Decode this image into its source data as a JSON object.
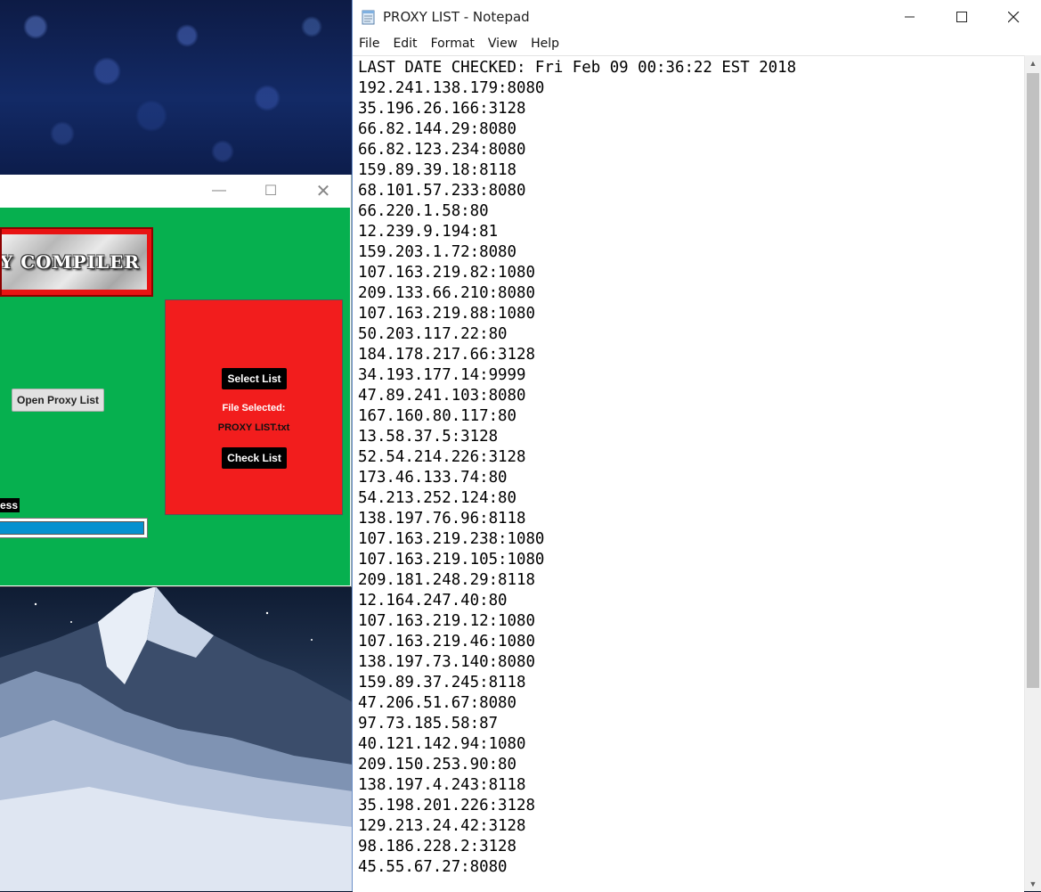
{
  "proxy_compiler": {
    "logo_text": "PROXY COMPILER",
    "open_button": "Open Proxy List",
    "select_button": "Select List",
    "file_selected_label": "File Selected:",
    "file_name": "PROXY LIST.txt",
    "check_button": "Check List",
    "status_label": "Progress:",
    "progress_fraction": 1.0,
    "colors": {
      "body": "#06b04f",
      "panel": "#f21d1d",
      "progress": "#0691d0"
    }
  },
  "notepad": {
    "title": "PROXY LIST - Notepad",
    "menu": [
      "File",
      "Edit",
      "Format",
      "View",
      "Help"
    ],
    "lines": [
      "LAST DATE CHECKED: Fri Feb 09 00:36:22 EST 2018",
      "192.241.138.179:8080",
      "35.196.26.166:3128",
      "66.82.144.29:8080",
      "66.82.123.234:8080",
      "159.89.39.18:8118",
      "68.101.57.233:8080",
      "66.220.1.58:80",
      "12.239.9.194:81",
      "159.203.1.72:8080",
      "107.163.219.82:1080",
      "209.133.66.210:8080",
      "107.163.219.88:1080",
      "50.203.117.22:80",
      "184.178.217.66:3128",
      "34.193.177.14:9999",
      "47.89.241.103:8080",
      "167.160.80.117:80",
      "13.58.37.5:3128",
      "52.54.214.226:3128",
      "173.46.133.74:80",
      "54.213.252.124:80",
      "138.197.76.96:8118",
      "107.163.219.238:1080",
      "107.163.219.105:1080",
      "209.181.248.29:8118",
      "12.164.247.40:80",
      "107.163.219.12:1080",
      "107.163.219.46:1080",
      "138.197.73.140:8080",
      "159.89.37.245:8118",
      "47.206.51.67:8080",
      "97.73.185.58:87",
      "40.121.142.94:1080",
      "209.150.253.90:80",
      "138.197.4.243:8118",
      "35.198.201.226:3128",
      "129.213.24.42:3128",
      "98.186.228.2:3128",
      "45.55.67.27:8080"
    ]
  }
}
